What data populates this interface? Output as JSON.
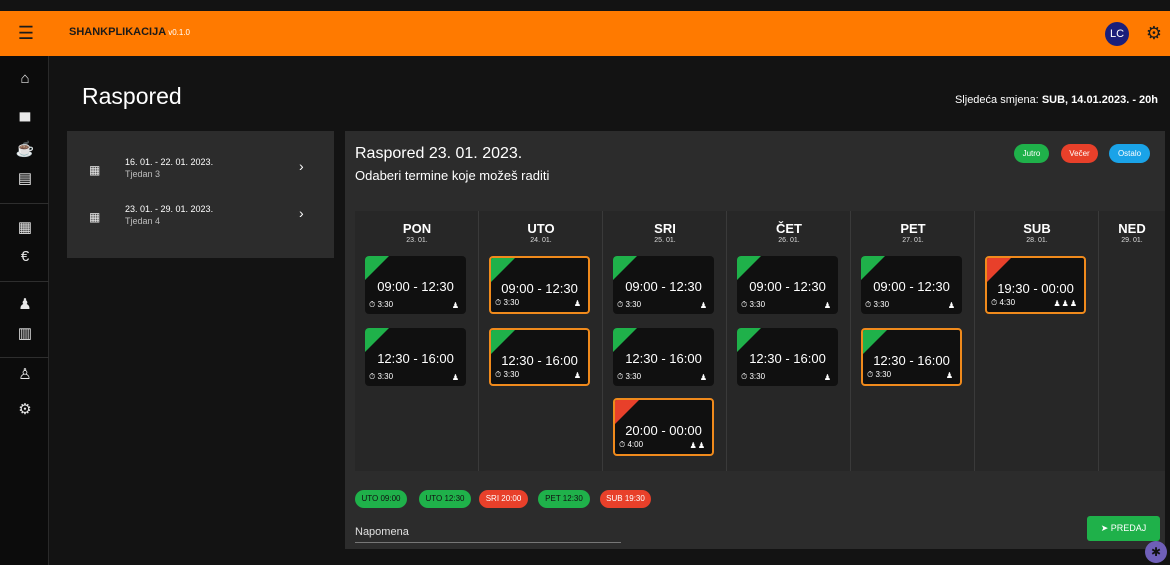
{
  "header": {
    "menu_icon": "☰",
    "brand": "SHANKPLIKACIJA",
    "version": "v0.1.0",
    "avatar": "LC",
    "settings_icon": "⚙"
  },
  "sidebar": {
    "icons": [
      {
        "name": "home-icon",
        "glyph": "⌂"
      },
      {
        "name": "building-icon",
        "glyph": "▀"
      },
      {
        "name": "beer-icon",
        "glyph": "☕"
      },
      {
        "name": "clipboard-icon",
        "glyph": "▤"
      },
      {
        "name": "calendar-icon",
        "glyph": "▦"
      },
      {
        "name": "euro-icon",
        "glyph": "€"
      },
      {
        "name": "group-icon",
        "glyph": "♟"
      },
      {
        "name": "inventory-icon",
        "glyph": "▥"
      },
      {
        "name": "person-icon",
        "glyph": "♙"
      },
      {
        "name": "settings-icon",
        "glyph": "⚙"
      }
    ]
  },
  "page": {
    "title": "Raspored",
    "next_shift_label": "Sljedeća smjena:",
    "next_shift_value": "SUB, 14.01.2023. - 20h"
  },
  "weeks": [
    {
      "range": "16. 01. - 22. 01. 2023.",
      "label": "Tjedan 3"
    },
    {
      "range": "23. 01. - 29. 01. 2023.",
      "label": "Tjedan 4"
    }
  ],
  "schedule": {
    "title": "Raspored 23. 01. 2023.",
    "subtitle": "Odaberi termine koje možeš raditi",
    "legend": [
      {
        "label": "Jutro",
        "color": "#1fb14a"
      },
      {
        "label": "Večer",
        "color": "#e8402a"
      },
      {
        "label": "Ostalo",
        "color": "#1aa3e8"
      }
    ],
    "days": [
      {
        "name": "PON",
        "date": "23. 01."
      },
      {
        "name": "UTO",
        "date": "24. 01."
      },
      {
        "name": "SRI",
        "date": "25. 01."
      },
      {
        "name": "ČET",
        "date": "26. 01."
      },
      {
        "name": "PET",
        "date": "27. 01."
      },
      {
        "name": "SUB",
        "date": "28. 01."
      },
      {
        "name": "NED",
        "date": "29. 01."
      }
    ],
    "shifts": {
      "pon1": {
        "time": "09:00 - 12:30",
        "dur": "3:30",
        "people": "♟"
      },
      "pon2": {
        "time": "12:30 - 16:00",
        "dur": "3:30",
        "people": "♟"
      },
      "uto1": {
        "time": "09:00 - 12:30",
        "dur": "3:30",
        "people": "♟"
      },
      "uto2": {
        "time": "12:30 - 16:00",
        "dur": "3:30",
        "people": "♟"
      },
      "sri1": {
        "time": "09:00 - 12:30",
        "dur": "3:30",
        "people": "♟"
      },
      "sri2": {
        "time": "12:30 - 16:00",
        "dur": "3:30",
        "people": "♟"
      },
      "sri3": {
        "time": "20:00 - 00:00",
        "dur": "4:00",
        "people": "♟♟"
      },
      "cet1": {
        "time": "09:00 - 12:30",
        "dur": "3:30",
        "people": "♟"
      },
      "cet2": {
        "time": "12:30 - 16:00",
        "dur": "3:30",
        "people": "♟"
      },
      "pet1": {
        "time": "09:00 - 12:30",
        "dur": "3:30",
        "people": "♟"
      },
      "pet2": {
        "time": "12:30 - 16:00",
        "dur": "3:30",
        "people": "♟"
      },
      "sub1": {
        "time": "19:30 - 00:00",
        "dur": "4:30",
        "people": "♟♟♟"
      }
    },
    "selected_chips": [
      "UTO 09:00",
      "UTO 12:30",
      "SRI 20:00",
      "PET 12:30",
      "SUB 19:30"
    ],
    "note_label": "Napomena",
    "submit_label": "PREDAJ",
    "submit_icon": "➤"
  }
}
